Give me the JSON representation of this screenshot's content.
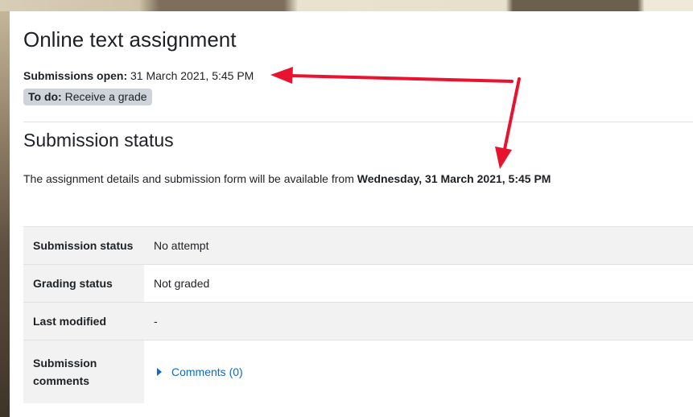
{
  "page": {
    "title": "Online text assignment"
  },
  "dates": {
    "open_label": "Submissions open:",
    "open_value": "31 March 2021, 5:45 PM"
  },
  "todo": {
    "label": "To do:",
    "value": "Receive a grade"
  },
  "submission": {
    "heading": "Submission status",
    "availability_text": "The assignment details and submission form will be available from ",
    "availability_date": "Wednesday, 31 March 2021, 5:45 PM",
    "rows": [
      {
        "label": "Submission status",
        "value": "No attempt"
      },
      {
        "label": "Grading status",
        "value": "Not graded"
      },
      {
        "label": "Last modified",
        "value": "-"
      },
      {
        "label": "Submission comments",
        "value": "Comments (0)"
      }
    ]
  },
  "colors": {
    "annotation_arrow": "#e8132f",
    "link": "#0f6cbf",
    "badge_bg": "#ced4da",
    "table_row_bg": "#f2f2f2"
  },
  "icons": {
    "comments_toggle": "caret-right-icon"
  }
}
